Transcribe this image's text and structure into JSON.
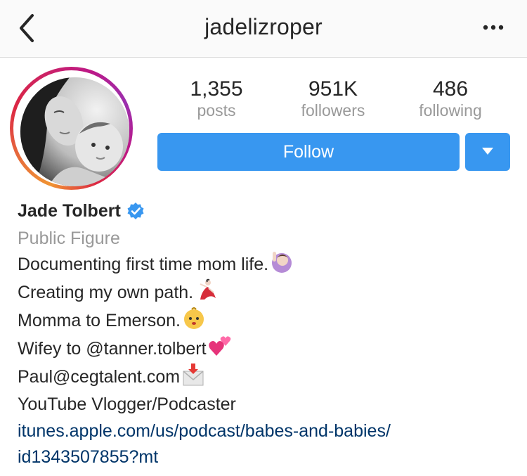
{
  "header": {
    "username": "jadelizroper",
    "back_icon": "chevron-left-icon",
    "more_icon": "ellipsis-icon"
  },
  "stats": {
    "posts": {
      "value": "1,355",
      "label": "posts"
    },
    "followers": {
      "value": "951K",
      "label": "followers"
    },
    "following": {
      "value": "486",
      "label": "following"
    }
  },
  "actions": {
    "follow_label": "Follow",
    "dropdown_icon": "triangle-down-icon"
  },
  "profile": {
    "name": "Jade Tolbert",
    "verified": true,
    "category": "Public Figure",
    "bio_lines": [
      {
        "text": "Documenting first time mom life.",
        "emoji": "raising-hand-emoji"
      },
      {
        "text": "Creating my own path.",
        "emoji": "dancer-emoji"
      },
      {
        "text": "Momma to Emerson.",
        "emoji": "baby-emoji"
      },
      {
        "text": "Wifey to @tanner.tolbert",
        "emoji": "two-hearts-emoji"
      },
      {
        "text": "Paul@cegtalent.com",
        "emoji": "envelope-arrow-emoji"
      },
      {
        "text": "YouTube Vlogger/Podcaster",
        "emoji": ""
      }
    ],
    "link_line1": "itunes.apple.com/us/podcast/babes-and-babies/",
    "link_line2": "id1343507855?mt"
  },
  "colors": {
    "accent": "#3897f0",
    "link": "#003569",
    "muted": "#999999",
    "verified": "#3897f0"
  }
}
